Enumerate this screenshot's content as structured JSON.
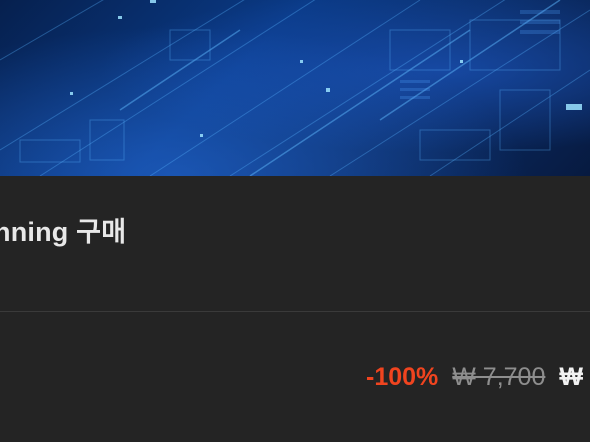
{
  "product": {
    "title": "nning 구매",
    "subtext": "ː"
  },
  "price": {
    "discount": "-100%",
    "original": "₩ 7,700",
    "final": "₩"
  },
  "colors": {
    "background": "#242424",
    "discount": "#f0441f",
    "banner_primary": "#0a3a86"
  }
}
